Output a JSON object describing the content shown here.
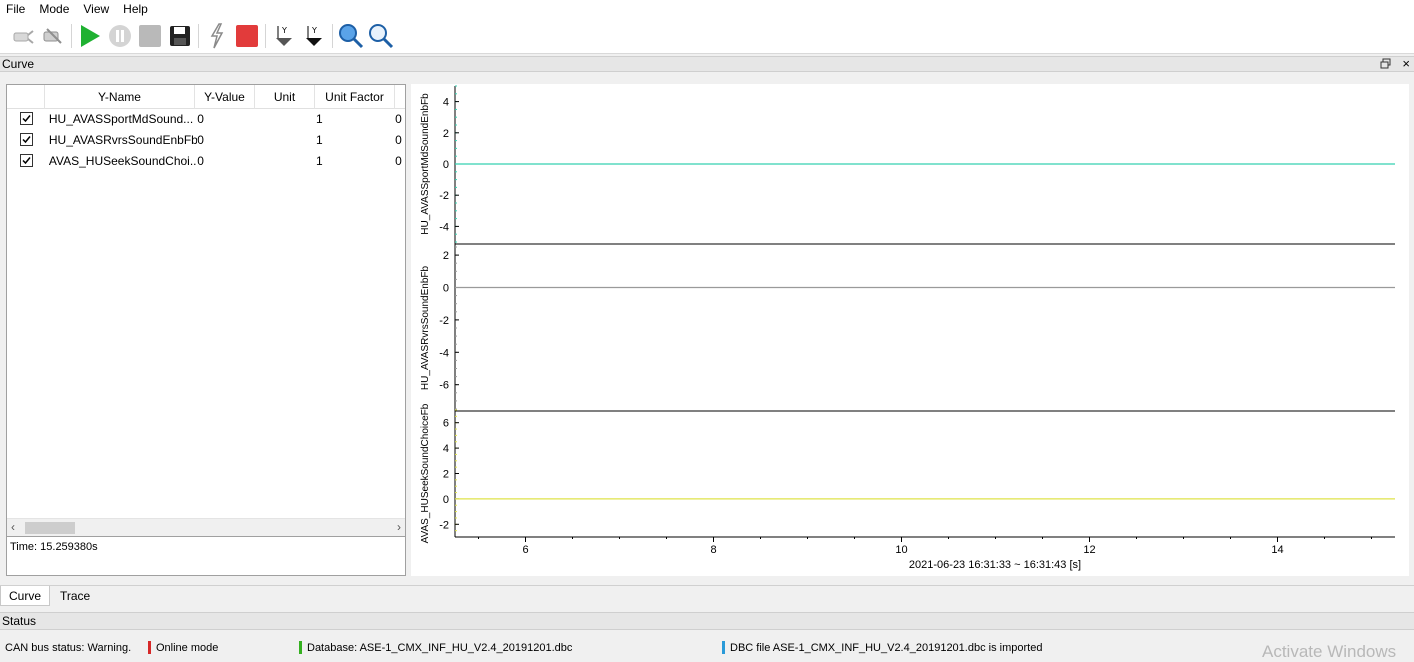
{
  "menu": [
    "File",
    "Mode",
    "View",
    "Help"
  ],
  "toolbar": {
    "buttons": [
      {
        "icon": "connect-icon"
      },
      {
        "icon": "disconnect-icon"
      },
      {
        "icon": "play-icon",
        "color": "#1fb131"
      },
      {
        "icon": "pause-icon"
      },
      {
        "icon": "stop-icon"
      },
      {
        "icon": "save-icon"
      },
      {
        "icon": "trigger-icon"
      },
      {
        "icon": "record-icon",
        "color": "#e23b3b"
      },
      {
        "icon": "y-axis-down-icon"
      },
      {
        "icon": "y-axis-up-icon"
      },
      {
        "icon": "zoom-in-icon"
      },
      {
        "icon": "zoom-out-icon"
      }
    ]
  },
  "dock": {
    "title": "Curve",
    "close": "×"
  },
  "table": {
    "columns": [
      "Y-Name",
      "Y-Value",
      "Unit",
      "Unit Factor"
    ],
    "rows": [
      {
        "name": "HU_AVASSportMdSound...",
        "value": "0",
        "unit": "",
        "factor": "1",
        "extra": "0",
        "checked": true
      },
      {
        "name": "HU_AVASRvrsSoundEnbFb",
        "value": "0",
        "unit": "",
        "factor": "1",
        "extra": "0",
        "checked": true
      },
      {
        "name": "AVAS_HUSeekSoundChoi...",
        "value": "0",
        "unit": "",
        "factor": "1",
        "extra": "0",
        "checked": true
      }
    ],
    "scroll_left": "‹",
    "scroll_right": "›"
  },
  "time_label": "Time: 15.259380s",
  "chart_data": {
    "type": "line",
    "x_range": [
      5.25,
      15.25
    ],
    "x_ticks": [
      6,
      8,
      10,
      12,
      14
    ],
    "xlabel": "2021-06-23 16:31:33 ~ 16:31:43   [s]",
    "panels": [
      {
        "ylabel": "HU_AVASSportMdSoundEnbFb",
        "ylim": [
          -5,
          5
        ],
        "y_ticks": [
          4,
          2,
          0,
          -2,
          -4
        ],
        "color": "#35d0b0",
        "value": 0
      },
      {
        "ylabel": "HU_AVASRvrsSoundEnbFb",
        "ylim": [
          -7.5,
          2.5
        ],
        "y_ticks": [
          2,
          0,
          -2,
          -4,
          -6
        ],
        "color": "#9a9a9a",
        "value": 0
      },
      {
        "ylabel": "AVAS_HUSeekSoundChoiceFb",
        "ylim": [
          -3,
          7
        ],
        "y_ticks": [
          6,
          4,
          2,
          0,
          -2
        ],
        "color": "#dfe34a",
        "value": 0
      }
    ]
  },
  "tabs": [
    "Curve",
    "Trace"
  ],
  "status": {
    "title": "Status",
    "items": [
      {
        "text": "CAN bus status: Warning.",
        "bar_color": "#d62828"
      },
      {
        "text": "Online mode",
        "bar_color": "#35b020"
      },
      {
        "text": "Database: ASE-1_CMX_INF_HU_V2.4_20191201.dbc",
        "bar_color": "#2a9ad8"
      },
      {
        "text": "DBC file ASE-1_CMX_INF_HU_V2.4_20191201.dbc is imported",
        "bar_color": ""
      }
    ]
  },
  "watermark": "Activate Windows"
}
